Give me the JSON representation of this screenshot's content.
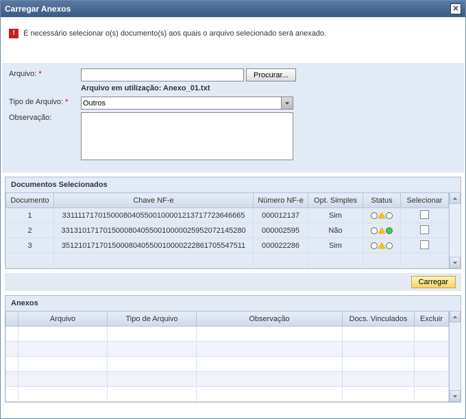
{
  "modal": {
    "title": "Carregar Anexos"
  },
  "message": "É necessário selecionar o(s) documento(s) aos quais o arquivo selecionado será anexado.",
  "form": {
    "file_label": "Arquivo:",
    "browse_label": "Procurar...",
    "file_in_use_prefix": "Arquivo em utilização: ",
    "file_in_use_name": "Anexo_01.txt",
    "type_label": "Tipo de Arquivo:",
    "type_value": "Outros",
    "obs_label": "Observação:"
  },
  "docs": {
    "title": "Documentos Selecionados",
    "cols": {
      "documento": "Documento",
      "chave": "Chave NF-e",
      "numero": "Número NF-e",
      "opt": "Opt. Simples",
      "status": "Status",
      "selecionar": "Selecionar"
    },
    "rows": [
      {
        "idx": "1",
        "chave": "33111171701500080405500100001213717723646665",
        "numero": "000012137",
        "opt": "Sim",
        "status": "std"
      },
      {
        "idx": "2",
        "chave": "33131017170150008040550010000025952072145280",
        "numero": "000002595",
        "opt": "Não",
        "status": "green"
      },
      {
        "idx": "3",
        "chave": "35121017170150008040550010000222861705547511",
        "numero": "000022286",
        "opt": "Sim",
        "status": "std"
      }
    ]
  },
  "actions": {
    "carregar": "Carregar"
  },
  "anexos": {
    "title": "Anexos",
    "cols": {
      "arquivo": "Arquivo",
      "tipo": "Tipo de Arquivo",
      "obs": "Observação",
      "docs": "Docs. Vinculados",
      "excluir": "Excluir"
    }
  },
  "bottom_cut": "Observação:"
}
